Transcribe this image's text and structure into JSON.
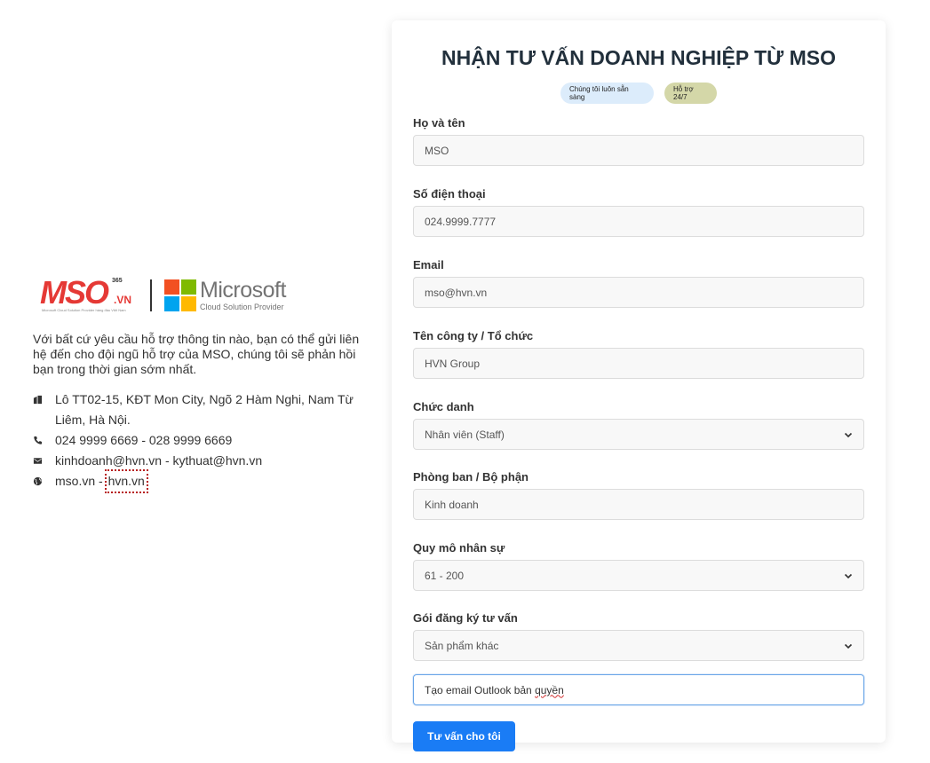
{
  "brand": {
    "mso_text": "MSO",
    "mso_suffix": ".VN",
    "mso_badge": "365",
    "mso_tagline": "Microsoft Cloud Solution Provider hàng đầu Việt Nam",
    "ms_name": "Microsoft",
    "ms_sub": "Cloud Solution Provider",
    "ms_colors": [
      "#f25022",
      "#7fba00",
      "#00a4ef",
      "#ffb900"
    ]
  },
  "intro": "Với bất cứ yêu cầu hỗ trợ thông tin nào, bạn có thể gửi liên hệ đến cho đội ngũ hỗ trợ của MSO, chúng tôi sẽ phản hồi bạn trong thời gian sớm nhất.",
  "contact": {
    "address": "Lô TT02-15, KĐT Mon City, Ngõ 2 Hàm Nghi, Nam Từ Liêm, Hà Nội.",
    "phone": "024 9999 6669 - 028 9999 6669",
    "email": "kinhdoanh@hvn.vn - kythuat@hvn.vn",
    "web_1": "mso.vn - ",
    "web_2": "hvn.vn"
  },
  "form": {
    "title": "NHẬN TƯ VẤN DOANH NGHIỆP TỪ MSO",
    "badge_1": "Chúng tôi luôn sẵn sàng",
    "badge_2": "Hỗ trợ 24/7",
    "name_label": "Họ và tên",
    "name_value": "MSO",
    "phone_label": "Số điện thoại",
    "phone_value": "024.9999.7777",
    "email_label": "Email",
    "email_value": "mso@hvn.vn",
    "company_label": "Tên công ty / Tổ chức",
    "company_value": "HVN Group",
    "position_label": "Chức danh",
    "position_value": "Nhân viên (Staff)",
    "department_label": "Phòng ban / Bộ phận",
    "department_value": "Kinh doanh",
    "size_label": "Quy mô nhân sự",
    "size_value": "61 - 200",
    "package_label": "Gói đăng ký tư vấn",
    "package_value": "Sản phẩm khác",
    "note_value_1": "Tạo email Outlook bản ",
    "note_value_2": "quyền",
    "submit_label": "Tư vấn cho tôi",
    "accent": "#1a7cf5"
  }
}
